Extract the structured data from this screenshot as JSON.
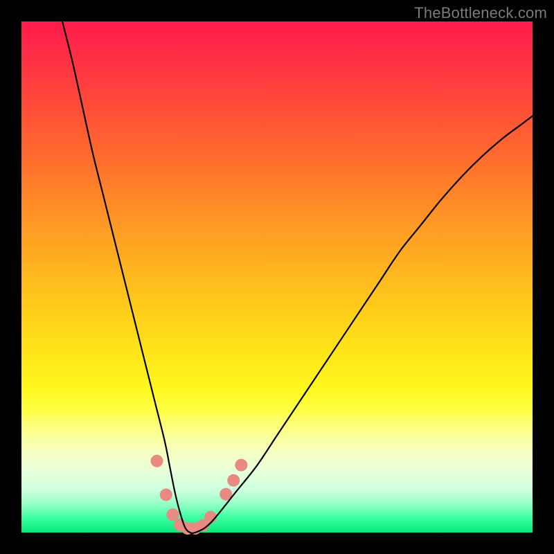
{
  "watermark": "TheBottleneck.com",
  "chart_data": {
    "type": "line",
    "title": "",
    "xlabel": "",
    "ylabel": "",
    "xlim": [
      0,
      100
    ],
    "ylim": [
      0,
      100
    ],
    "grid": false,
    "series": [
      {
        "name": "bottleneck-curve",
        "color": "#000000",
        "x": [
          8,
          10,
          12,
          14,
          16,
          18,
          20,
          22,
          24,
          26,
          28,
          29,
          30,
          31,
          32,
          33,
          34,
          36,
          38,
          42,
          46,
          50,
          54,
          58,
          62,
          66,
          70,
          74,
          78,
          82,
          86,
          90,
          94,
          98,
          100
        ],
        "values": [
          100,
          92,
          83,
          74,
          66,
          58,
          50,
          42,
          34,
          26,
          18,
          13,
          8,
          4,
          1,
          0,
          0,
          1,
          3,
          8,
          13,
          19,
          25,
          31,
          37,
          43,
          49,
          55,
          60,
          65,
          69.5,
          73.5,
          77,
          80,
          81.5
        ]
      }
    ],
    "markers": {
      "name": "highlight-dots",
      "color": "#e98a82",
      "radius": 9,
      "points": [
        {
          "x": 26.5,
          "y": 14
        },
        {
          "x": 28.3,
          "y": 7.4
        },
        {
          "x": 29.6,
          "y": 3.5
        },
        {
          "x": 31.0,
          "y": 1.5
        },
        {
          "x": 32.5,
          "y": 0.8
        },
        {
          "x": 34.0,
          "y": 0.8
        },
        {
          "x": 35.5,
          "y": 1.4
        },
        {
          "x": 37.0,
          "y": 3.0
        },
        {
          "x": 40.0,
          "y": 7.5
        },
        {
          "x": 41.5,
          "y": 10.2
        },
        {
          "x": 43.0,
          "y": 13.2
        }
      ]
    },
    "background_gradient": {
      "top": "#ff1a4d",
      "bottom": "#06e87a"
    }
  }
}
